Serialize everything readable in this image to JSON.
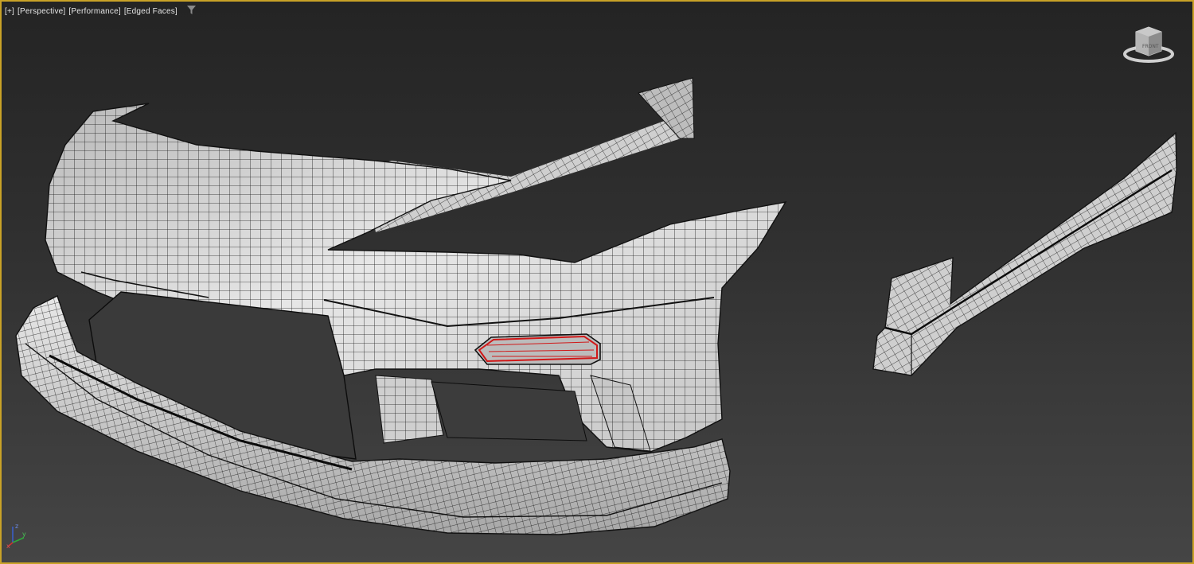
{
  "viewport": {
    "labels": [
      "[+]",
      "[Perspective]",
      "[Performance]",
      "[Edged Faces]"
    ],
    "filter_icon": "filter-icon",
    "border_color": "#c9a227",
    "background_top": "#242424",
    "background_bottom": "#454545"
  },
  "scene": {
    "mesh_fill": "#d8d8d8",
    "mesh_edge_color": "#1a1a1a",
    "selection_color": "#d01818",
    "objects": [
      "front-bumper",
      "front-lip-spoiler",
      "side-skirt-left",
      "side-skirt-right",
      "fog-light-opening"
    ]
  },
  "viewcube": {
    "icon": "viewcube-icon",
    "face_label": "FRONT"
  },
  "axis_tripod": {
    "icon": "axis-tripod-icon",
    "x_label": "x",
    "y_label": "y",
    "z_label": "z"
  }
}
